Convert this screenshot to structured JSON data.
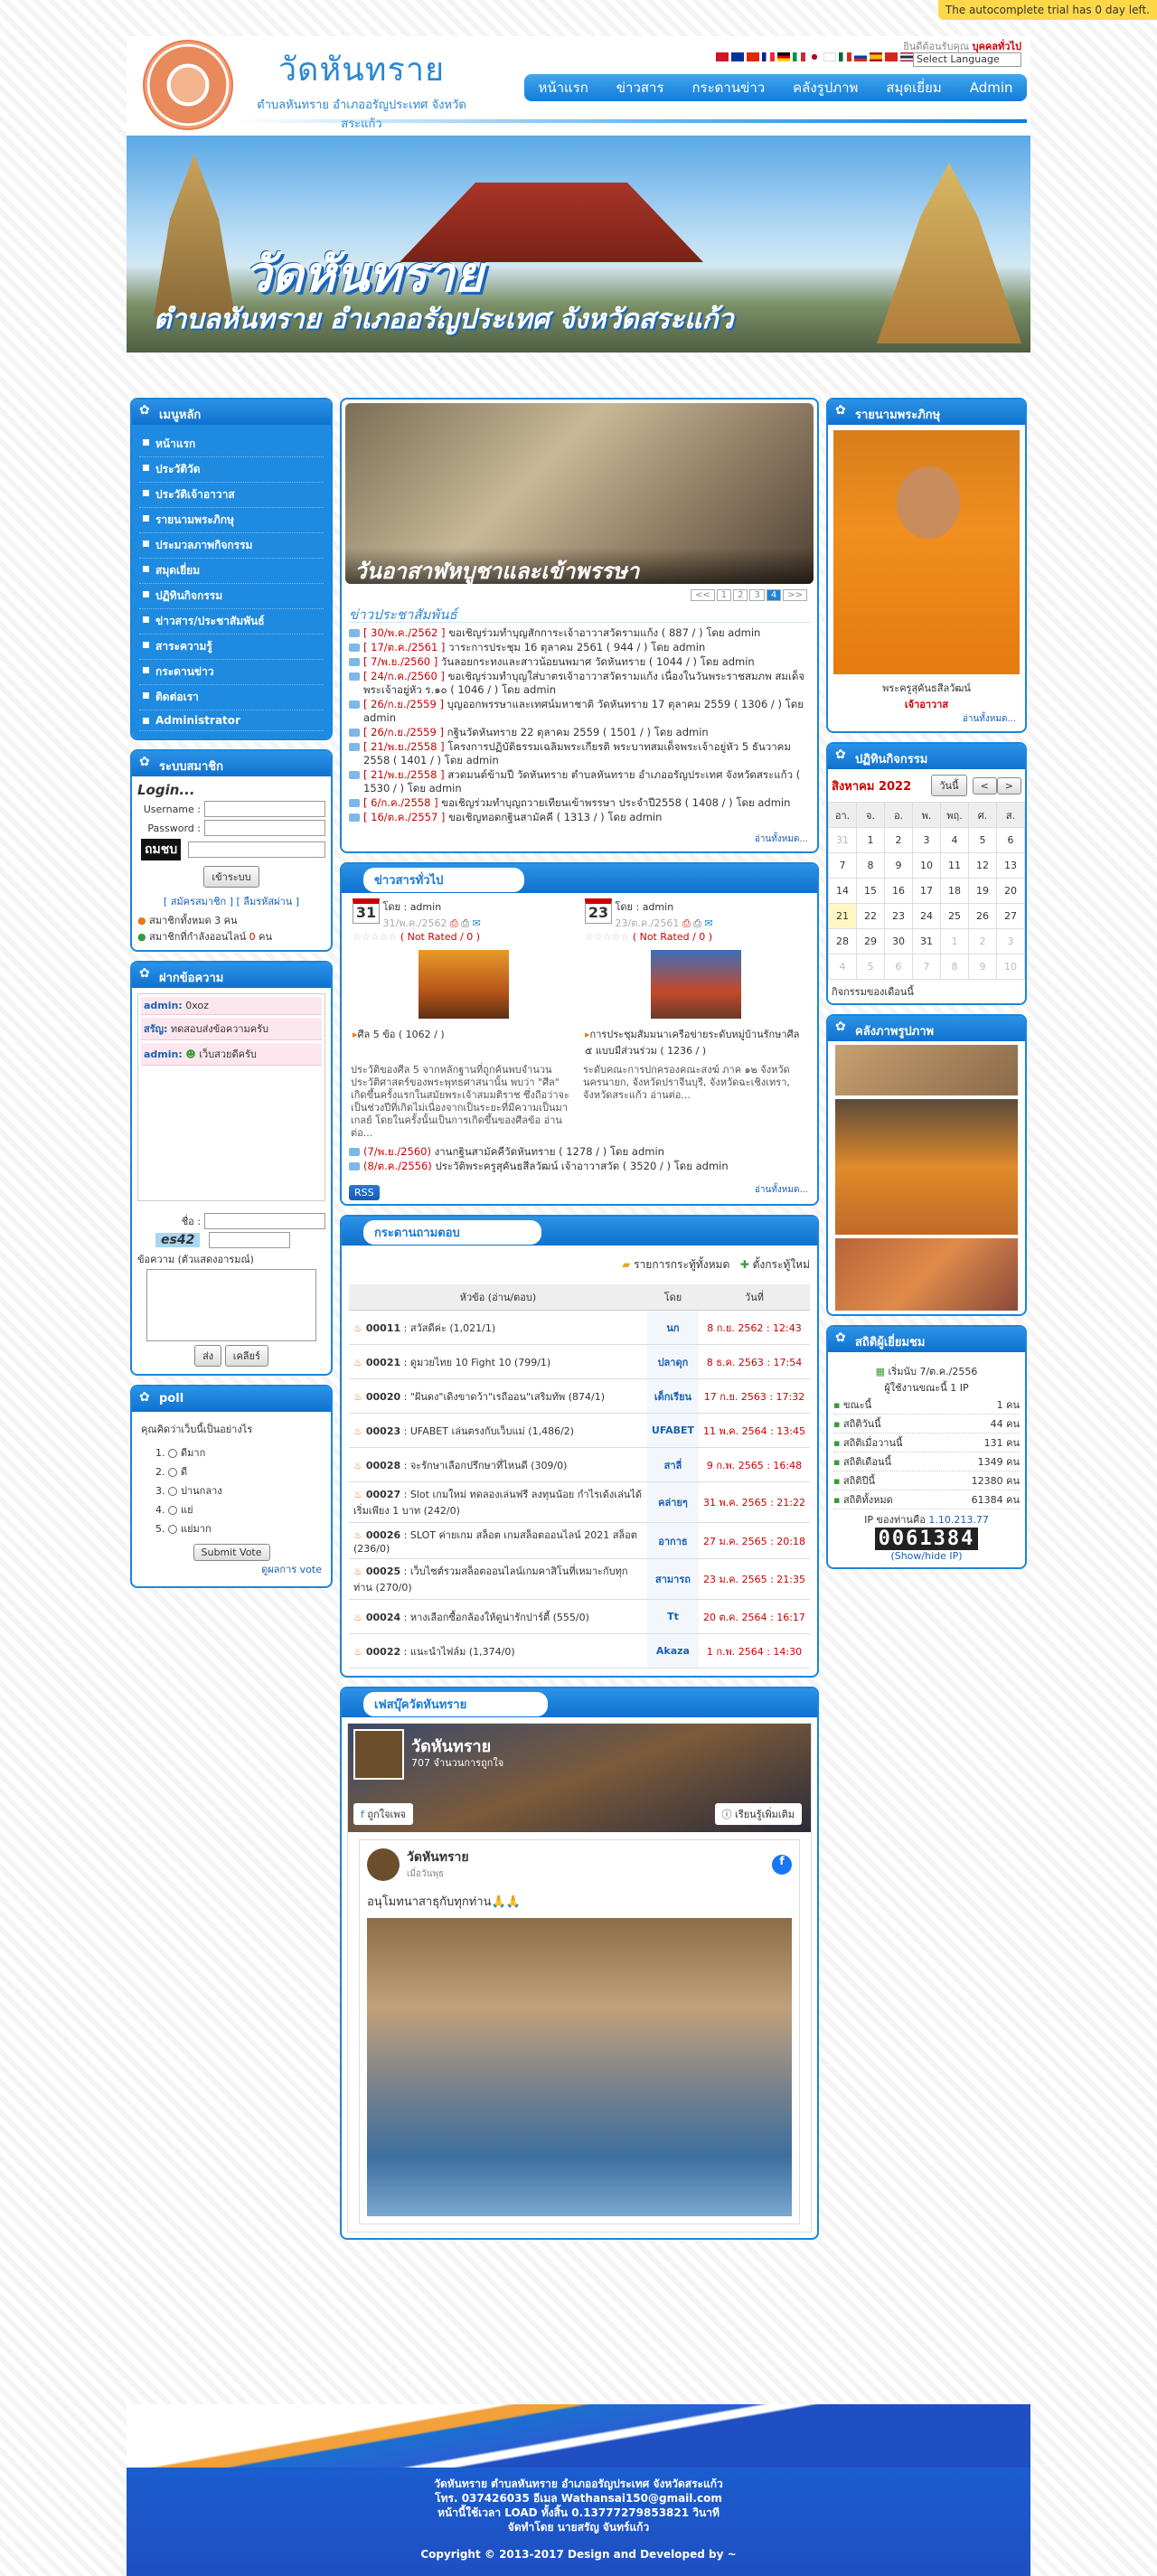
{
  "trial_notice": "The autocomplete trial has 0 day left.",
  "header": {
    "site_name": "วัดหันทราย",
    "site_sub": "ตำบลหันทราย อำเภออรัญประเทศ จังหวัดสระแก้ว",
    "member_area_prefix": "ยินดีต้อนรับคุณ",
    "member_area_user": "บุคคลทั่วไป",
    "language_select": "Select Language",
    "nav": [
      "หน้าแรก",
      "ข่าวสาร",
      "กระดานข่าว",
      "คลังรูปภาพ",
      "สมุดเยี่ยม",
      "Admin"
    ]
  },
  "banner": {
    "title": "วัดหันทราย",
    "subtitle": "ตำบลหันทราย อำเภออรัญประเทศ จังหวัดสระแก้ว"
  },
  "left": {
    "menu_title": "เมนูหลัก",
    "menu": [
      "หน้าแรก",
      "ประวัติวัด",
      "ประวัติเจ้าอาวาส",
      "รายนามพระภิกษุ",
      "ประมวลภาพกิจกรรม",
      "สมุดเยี่ยม",
      "ปฏิทินกิจกรรม",
      "ข่าวสาร/ประชาสัมพันธ์",
      "สาระความรู้",
      "กระดานข่าว",
      "ติดต่อเรา",
      "Administrator"
    ],
    "member_title": "ระบบสมาชิก",
    "login_title": "Login...",
    "username_label": "Username :",
    "password_label": "Password :",
    "captcha": "ถมชบ",
    "login_btn": "เข้าระบบ",
    "register": "[ สมัครสมาชิก ] [ ลืมรหัสผ่าน ]",
    "members_total": "สมาชิกทั้งหมด 3 คน",
    "members_online_prefix": "สมาชิกที่กำลังออนไลน์",
    "members_online_count": "0",
    "members_online_suffix": "คน",
    "shout_title": "ฝากข้อความ",
    "shouts": [
      {
        "user": "admin:",
        "msg": "0xoz"
      },
      {
        "user": "สรัญ:",
        "msg": "ทดสอบส่งข้อความครับ"
      },
      {
        "user": "admin:",
        "msg": "เว็บสวยดีครับ"
      }
    ],
    "name_label": "ชื่อ :",
    "captcha2": "es42",
    "message_label": "ข้อความ (ตัวแสดงอารมณ์)",
    "send_btn": "ส่ง",
    "clear_btn": "เคลียร์",
    "poll_title": "poll",
    "poll_question": "คุณคิดว่าเว็บนี้เป็นอย่างไร",
    "poll_options": [
      "ดีมาก",
      "ดี",
      "ปานกลาง",
      "แย่",
      "แย่มาก"
    ],
    "poll_btn": "Submit Vote",
    "poll_result": "ดูผลการ vote"
  },
  "center": {
    "slide_caption": "วันอาสาฬหบูชาและเข้าพรรษา",
    "pager": [
      "<<",
      "1",
      "2",
      "3",
      "4",
      ">>"
    ],
    "news_title": "ข่าวประชาสัมพันธ์",
    "news": [
      {
        "date": "[ 30/พ.ค./2562 ]",
        "text": "ขอเชิญร่วมทำบุญสักการะเจ้าอาวาสวัดรามแก้ง ( 887 / ) โดย admin"
      },
      {
        "date": "[ 17/ต.ค./2561 ]",
        "text": "วาระการประชุม 16 ตุลาคม 2561 ( 944 / ) โดย admin"
      },
      {
        "date": "[ 7/พ.ย./2560 ]",
        "text": "วันลอยกระทงและสาวน้อยนพมาศ วัดหันทราย ( 1044 / ) โดย admin"
      },
      {
        "date": "[ 24/ก.ค./2560 ]",
        "text": "ขอเชิญร่วมทำบุญใส่บาตรเจ้าอาวาสวัดรามแก้ง เนื่องในวันพระราชสมภพ สมเด็จพระเจ้าอยู่หัว ร.๑๐ ( 1046 / ) โดย admin"
      },
      {
        "date": "[ 26/ก.ย./2559 ]",
        "text": "บุญออกพรรษาและเทศน์มหาชาติ วัดหันทราย 17 ตุลาคม 2559 ( 1306 / ) โดย admin"
      },
      {
        "date": "[ 26/ก.ย./2559 ]",
        "text": "กฐินวัดหันทราย 22 ตุลาคม 2559 ( 1501 / ) โดย admin"
      },
      {
        "date": "[ 21/พ.ย./2558 ]",
        "text": "โครงการปฏิบัติธรรมเฉลิมพระเกียรติ พระบาทสมเด็จพระเจ้าอยู่หัว 5 ธันวาคม 2558 ( 1401 / ) โดย admin"
      },
      {
        "date": "[ 21/พ.ย./2558 ]",
        "text": "สวดมนต์ข้ามปี วัดหันทราย ตำบลหันทราย อำเภออรัญประเทศ จังหวัดสระแก้ว ( 1530 / ) โดย admin"
      },
      {
        "date": "[ 6/ก.ค./2558 ]",
        "text": "ขอเชิญร่วมทำบุญถวายเทียนเข้าพรรษา ประจำปี2558 ( 1408 / ) โดย admin"
      },
      {
        "date": "[ 16/ต.ค./2557 ]",
        "text": "ขอเชิญทอดกฐินสามัคคี ( 1313 / ) โดย admin"
      }
    ],
    "more": "อ่านทั้งหมด...",
    "general_title": "ข่าวสารทั่วไป",
    "articles": [
      {
        "day": "31",
        "by": "โดย : admin",
        "date": "31/พ.ค./2562",
        "rating": "( Not Rated / 0 )",
        "title": "ศีล 5 ข้อ",
        "views": "( 1062 / )",
        "body": "ประวัติของศีล 5 จากหลักฐานที่ถูกค้นพบจำนวนประวัติศาสตร์ของพระพุทธศาสนานั้น พบว่า \"ศีล\" เกิดขึ้นครั้งแรกในสมัยพระเจ้าสมมติราช ซึ่งถือว่าจะเป็นช่วงปีที่เกิดไม่เนื่องจากเป็นระยะที่มีความเป็นมาเกลย์ โดยในครั้งนั้นเป็นการเกิดขึ้นของศีลข้อ อ่านต่อ..."
      },
      {
        "day": "23",
        "by": "โดย : admin",
        "date": "23/ต.ค./2561",
        "rating": "( Not Rated / 0 )",
        "title": "การประชุมสัมมนาเครือข่ายระดับหมู่บ้านรักษาศีล ๕ แบบมีส่วนร่วม",
        "views": "( 1236 / )",
        "body": "ระดับคณะการปกครองคณะสงฆ์ ภาค ๑๒ จังหวัดนครนายก, จังหวัดปราจีนบุรี, จังหวัดฉะเชิงเทรา, จังหวัดสระแก้ว อ่านต่อ..."
      }
    ],
    "general_list": [
      {
        "date": "(7/พ.ย./2560)",
        "text": "งานกฐินสามัคคีวัดหันทราย ( 1278 / ) โดย admin"
      },
      {
        "date": "(8/ต.ค./2556)",
        "text": "ประวัติพระครูสุคันธสีลวัฒน์ เจ้าอาวาสวัด ( 3520 / ) โดย admin"
      }
    ],
    "rss": "RSS",
    "board_title": "กระดานถามตอบ",
    "board_all": "รายการกระทู้ทั้งหมด",
    "board_new": "ตั้งกระทู้ใหม่",
    "board_cols": [
      "หัวข้อ (อ่าน/ตอบ)",
      "โดย",
      "วันที่"
    ],
    "board": [
      {
        "id": "00011",
        "title": "สวัสดีค่ะ (1,021/1)",
        "by": "นก",
        "date": "8 ก.ย. 2562 : 12:43"
      },
      {
        "id": "00021",
        "title": "ดูมวยไทย 10 Fight 10 (799/1)",
        "by": "ปลาดุก",
        "date": "8 ธ.ค. 2563 : 17:54"
      },
      {
        "id": "00020",
        "title": "\"ฝันดง\"เดิงขาดว้า\"เรถีออน\"เสริมทัพ (874/1)",
        "by": "เด็กเรียน",
        "date": "17 ก.ย. 2563 : 17:32"
      },
      {
        "id": "00023",
        "title": "UFABET เล่นตรงกับเว็บแม่ (1,486/2)",
        "by": "UFABET",
        "date": "11 พ.ค. 2564 : 13:45"
      },
      {
        "id": "00028",
        "title": "จะรักษาเลือกปรึกษาที่ไหนดี (309/0)",
        "by": "สาลี่",
        "date": "9 ก.พ. 2565 : 16:48"
      },
      {
        "id": "00027",
        "title": "Slot เกมใหม่ ทดลองเล่นฟรี ลงทุนน้อย กำไรเด้งเล่นได้ เริ่มเพียง 1 บาท (242/0)",
        "by": "คล่ายๆ",
        "date": "31 พ.ค. 2565 : 21:22"
      },
      {
        "id": "00026",
        "title": "SLOT ค่ายเกม สล็อต เกมสล็อตออนไลน์ 2021 สล็อต (236/0)",
        "by": "อากาธ",
        "date": "27 ม.ค. 2565 : 20:18"
      },
      {
        "id": "00025",
        "title": "เว็บไซต์รวมสล็อตออนไลน์เกมคาสิโนที่เหมาะกับทุกท่าน (270/0)",
        "by": "สามารถ",
        "date": "23 ม.ค. 2565 : 21:35"
      },
      {
        "id": "00024",
        "title": "หางเลือกซื้อกล้องให้ดูน่ารักปาร์ตี้ (555/0)",
        "by": "Tt",
        "date": "20 ต.ค. 2564 : 16:17"
      },
      {
        "id": "00022",
        "title": "แนะนำไฟล์ม (1,374/0)",
        "by": "Akaza",
        "date": "1 ก.พ. 2564 : 14:30"
      }
    ],
    "fb_title": "เฟสบุ๊ควัดหันทราย",
    "fb_name": "วัดหันทราย",
    "fb_likes": "707 จำนวนการถูกใจ",
    "fb_like_btn": "ถูกใจเพจ",
    "fb_learn_btn": "เรียนรู้เพิ่มเติม",
    "fb_post_name": "วัดหันทราย",
    "fb_post_time": "เมื่อวันพุธ",
    "fb_post_text": "อนุโมทนาสาธุกับทุกท่าน🙏🙏"
  },
  "right": {
    "monks_title": "รายนามพระภิกษุ",
    "monk_name": "พระครูสุคันธสีลวัฒน์",
    "monk_role": "เจ้าอาวาส",
    "monk_more": "อ่านทั้งหมด...",
    "cal_title": "ปฏิทินกิจกรรม",
    "cal_month": "สิงหาคม 2022",
    "cal_today": "วันนี้",
    "cal_days": [
      "อา.",
      "จ.",
      "อ.",
      "พ.",
      "พฤ.",
      "ศ.",
      "ส."
    ],
    "cal_rows": [
      [
        "31",
        "1",
        "2",
        "3",
        "4",
        "5",
        "6"
      ],
      [
        "7",
        "8",
        "9",
        "10",
        "11",
        "12",
        "13"
      ],
      [
        "14",
        "15",
        "16",
        "17",
        "18",
        "19",
        "20"
      ],
      [
        "21",
        "22",
        "23",
        "24",
        "25",
        "26",
        "27"
      ],
      [
        "28",
        "29",
        "30",
        "31",
        "1",
        "2",
        "3"
      ],
      [
        "4",
        "5",
        "6",
        "7",
        "8",
        "9",
        "10"
      ]
    ],
    "cal_footer": "กิจกรรมของเดือนนี้",
    "gallery_title": "คลังภาพรูปภาพ",
    "stats_title": "สถิติผู้เยี่ยมชม",
    "stats_since": "เริ่มนับ 7/ต.ค./2556",
    "stats_online": "ผู้ใช้งานขณะนี้ 1 IP",
    "stats": [
      {
        "label": "ขณะนี้",
        "value": "1 คน"
      },
      {
        "label": "สถิติวันนี้",
        "value": "44 คน"
      },
      {
        "label": "สถิติเมื่อวานนี้",
        "value": "131 คน"
      },
      {
        "label": "สถิติเดือนนี้",
        "value": "1349 คน"
      },
      {
        "label": "สถิติปีนี้",
        "value": "12380 คน"
      },
      {
        "label": "สถิติทั้งหมด",
        "value": "61384 คน"
      }
    ],
    "ip_label": "IP ของท่านคือ",
    "ip": "1.10.213.77",
    "counter": "0061384",
    "show_ip": "(Show/hide IP)"
  },
  "footer": {
    "line1": "วัดหันทราย ตำบลหันทราย อำเภออรัญประเทศ จังหวัดสระแก้ว",
    "line2": "โทร. 037426035 อีเมล Wathansai150@gmail.com",
    "line3": "หน้านี้ใช้เวลา LOAD ทั้งสิ้น 0.13777279853821 วินาที",
    "line4": "จัดทำโดย นายสรัญ จันทร์แก้ว",
    "copyright": "Copyright © 2013-2017 Design and Developed by ~"
  }
}
